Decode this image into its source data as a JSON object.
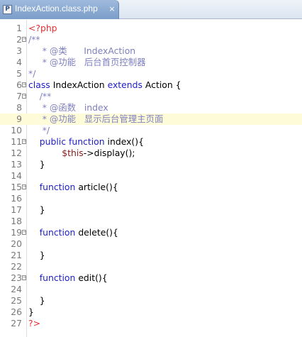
{
  "tab": {
    "icon_letter": "P",
    "title": "IndexAction.class.php",
    "close": "×"
  },
  "lines": [
    {
      "n": "1",
      "t": [
        [
          "php",
          "<?php"
        ]
      ]
    },
    {
      "n": "2",
      "fold": true,
      "t": [
        [
          "cmt",
          "/**"
        ]
      ]
    },
    {
      "n": "3",
      "t": [
        [
          "cmt",
          "     * @类      IndexAction"
        ]
      ]
    },
    {
      "n": "4",
      "t": [
        [
          "cmt",
          "     * @功能   后台首页控制器"
        ]
      ]
    },
    {
      "n": "5",
      "t": [
        [
          "cmt",
          "*/"
        ]
      ]
    },
    {
      "n": "6",
      "fold": true,
      "t": [
        [
          "kw",
          "class "
        ],
        [
          "pl",
          "IndexAction "
        ],
        [
          "kw",
          "extends "
        ],
        [
          "pl",
          "Action {"
        ]
      ]
    },
    {
      "n": "7",
      "fold": true,
      "t": [
        [
          "cmt",
          "    /**"
        ]
      ]
    },
    {
      "n": "8",
      "t": [
        [
          "cmt",
          "     * @函数   index"
        ]
      ]
    },
    {
      "n": "9",
      "hl": true,
      "t": [
        [
          "cmt",
          "     * @功能   显示后台管理主页面"
        ]
      ]
    },
    {
      "n": "10",
      "t": [
        [
          "cmt",
          "     */"
        ]
      ]
    },
    {
      "n": "11",
      "fold": true,
      "t": [
        [
          "kw",
          "    public function "
        ],
        [
          "pl",
          "index(){"
        ]
      ]
    },
    {
      "n": "12",
      "t": [
        [
          "var",
          "            $this"
        ],
        [
          "pl",
          "->display();"
        ]
      ]
    },
    {
      "n": "13",
      "t": [
        [
          "pl",
          "    }"
        ]
      ]
    },
    {
      "n": "14",
      "t": []
    },
    {
      "n": "15",
      "fold": true,
      "t": [
        [
          "kw",
          "    function "
        ],
        [
          "pl",
          "article(){"
        ]
      ]
    },
    {
      "n": "16",
      "t": []
    },
    {
      "n": "17",
      "t": [
        [
          "pl",
          "    }"
        ]
      ]
    },
    {
      "n": "18",
      "t": []
    },
    {
      "n": "19",
      "fold": true,
      "t": [
        [
          "kw",
          "    function "
        ],
        [
          "pl",
          "delete(){"
        ]
      ]
    },
    {
      "n": "20",
      "t": []
    },
    {
      "n": "21",
      "t": [
        [
          "pl",
          "    }"
        ]
      ]
    },
    {
      "n": "22",
      "t": []
    },
    {
      "n": "23",
      "fold": true,
      "t": [
        [
          "kw",
          "    function "
        ],
        [
          "pl",
          "edit(){"
        ]
      ]
    },
    {
      "n": "24",
      "t": []
    },
    {
      "n": "25",
      "t": [
        [
          "pl",
          "    }"
        ]
      ]
    },
    {
      "n": "26",
      "t": [
        [
          "pl",
          "}"
        ]
      ]
    },
    {
      "n": "27",
      "t": [
        [
          "php",
          "?>"
        ]
      ]
    }
  ],
  "colors": {
    "php_tag": "#e03030",
    "comment": "#7f7fbf",
    "keyword": "#1d1dc8",
    "variable": "#8a1a1a",
    "current_line": "#fefcd8"
  }
}
